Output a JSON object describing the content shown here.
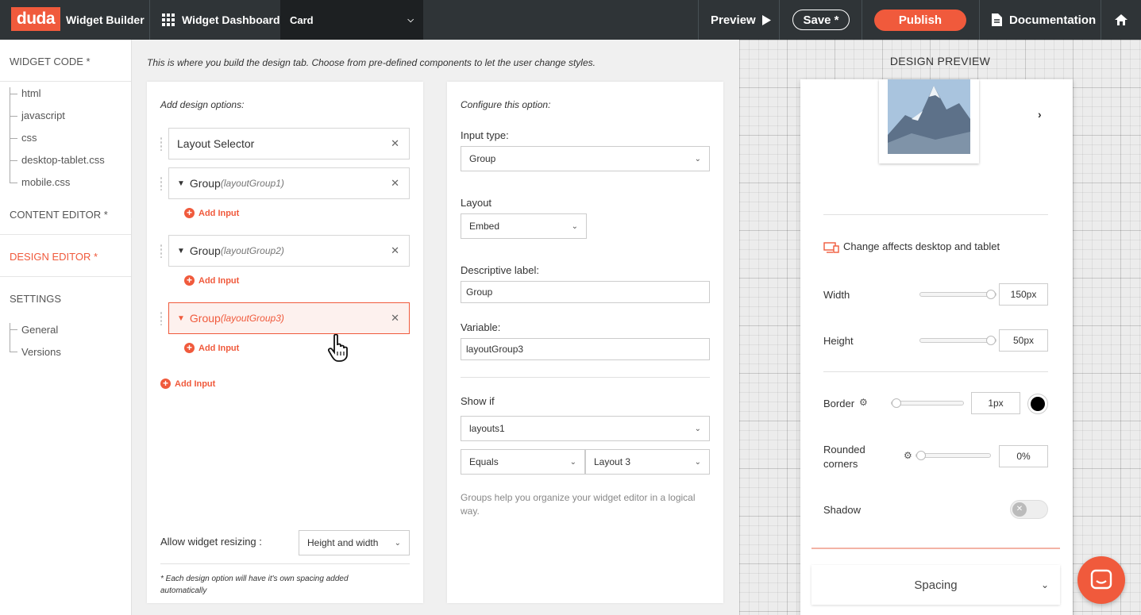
{
  "topbar": {
    "logo": "duda",
    "app_name": "Widget Builder",
    "dashboard_label": "Widget Dashboard",
    "widget_select": "Card",
    "preview_label": "Preview",
    "save_label": "Save *",
    "publish_label": "Publish",
    "documentation_label": "Documentation"
  },
  "sidebar": {
    "widget_code": "WIDGET CODE *",
    "files": [
      "html",
      "javascript",
      "css",
      "desktop-tablet.css",
      "mobile.css"
    ],
    "content_editor": "CONTENT EDITOR *",
    "design_editor": "DESIGN EDITOR *",
    "settings": "SETTINGS",
    "settings_items": [
      "General",
      "Versions"
    ]
  },
  "main": {
    "intro": "This is where you build the design tab. Choose from pre-defined components to let the user change styles.",
    "options_title": "Add design options:",
    "options": [
      {
        "label": "Layout Selector",
        "sub": ""
      },
      {
        "label": "Group",
        "sub": "(layoutGroup1)"
      },
      {
        "label": "Group",
        "sub": "(layoutGroup2)"
      },
      {
        "label": "Group",
        "sub": "(layoutGroup3)"
      }
    ],
    "add_input": "Add Input",
    "allow_resizing_label": "Allow widget resizing :",
    "allow_resizing_value": "Height and width",
    "footnote": "* Each design option will have it's own spacing added automatically"
  },
  "config": {
    "title": "Configure this option:",
    "input_type_label": "Input type:",
    "input_type_value": "Group",
    "layout_label": "Layout",
    "layout_value": "Embed",
    "desc_label": "Descriptive label:",
    "desc_value": "Group",
    "variable_label": "Variable:",
    "variable_value": "layoutGroup3",
    "show_if_label": "Show if",
    "show_if_field": "layouts1",
    "show_if_op": "Equals",
    "show_if_value": "Layout 3",
    "help": "Groups help you organize your widget editor in a logical way."
  },
  "preview": {
    "title": "DESIGN PREVIEW",
    "device_note": "Change affects desktop and tablet",
    "width_label": "Width",
    "width_value": "150px",
    "width_level": 1.0,
    "height_label": "Height",
    "height_value": "50px",
    "height_level": 1.0,
    "border_label": "Border",
    "border_value": "1px",
    "border_color": "#000000",
    "border_level": 0.0,
    "rounded_label": "Rounded corners",
    "rounded_value": "0%",
    "rounded_level": 0.0,
    "shadow_label": "Shadow",
    "shadow_on": false,
    "spacing_label": "Spacing"
  },
  "colors": {
    "accent": "#f05a3c",
    "topbar": "#2f3437"
  }
}
